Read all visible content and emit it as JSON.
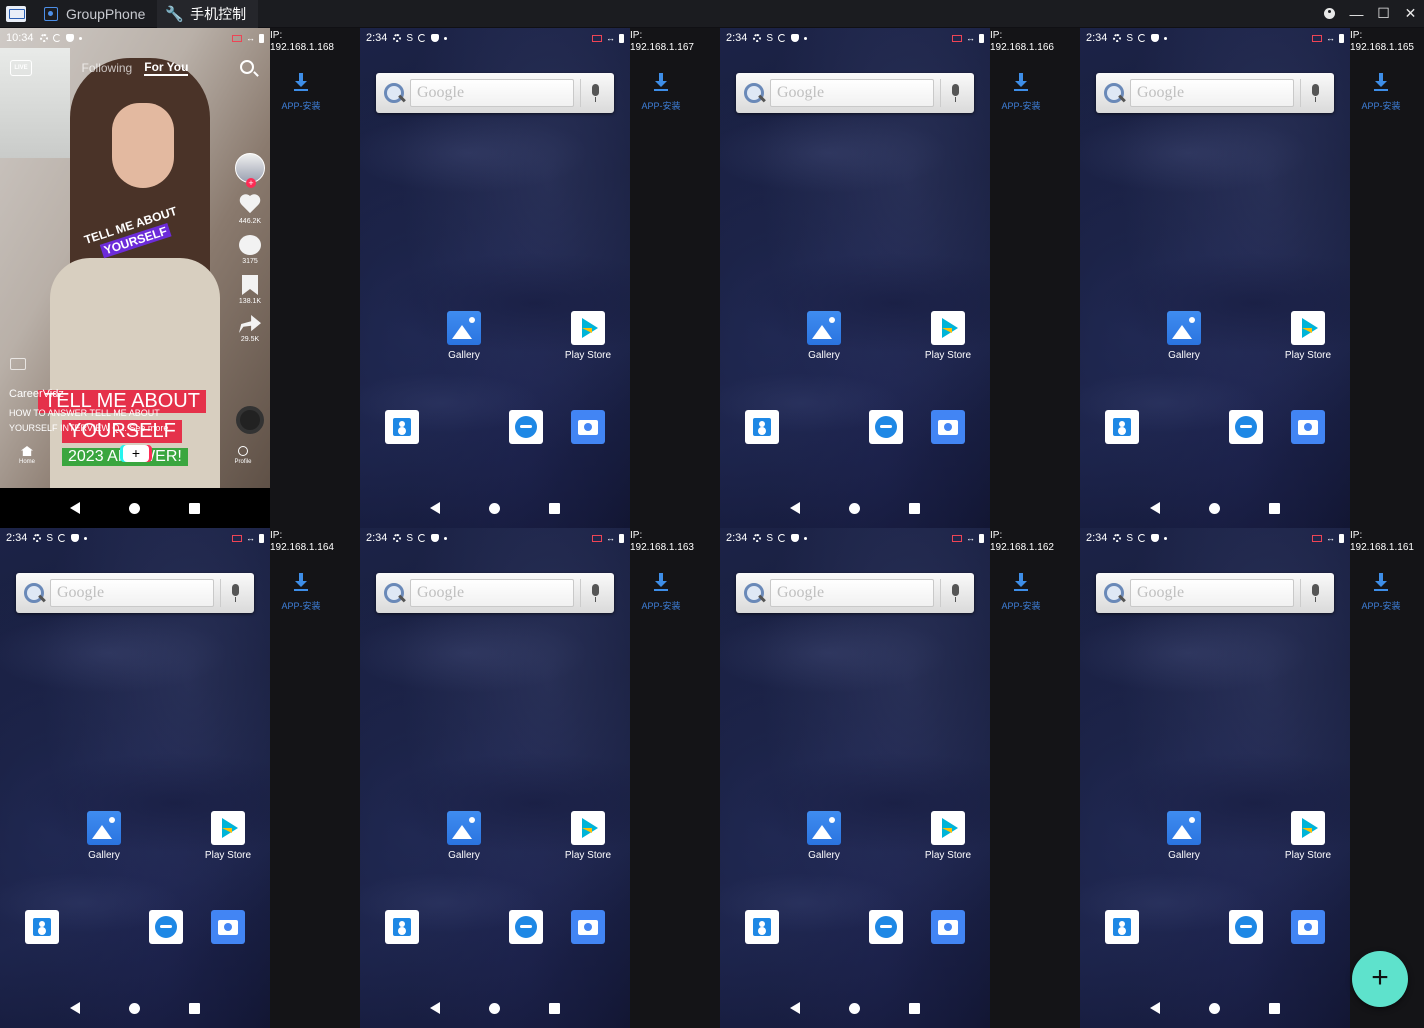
{
  "window": {
    "tabs": [
      {
        "label": "GroupPhone",
        "active": false,
        "icon": "phone-icon"
      },
      {
        "label": "手机控制",
        "active": true,
        "icon": "wrench-icon"
      }
    ],
    "controls": [
      "account-icon",
      "minimize-icon",
      "maximize-icon",
      "close-icon"
    ]
  },
  "install_label": "APP-安装",
  "fab_label": "+",
  "home_screen": {
    "search_placeholder": "Google",
    "apps": [
      {
        "label": "Gallery",
        "icon": "gallery-icon"
      },
      {
        "label": "Play Store",
        "icon": "play-store-icon"
      }
    ],
    "dock": [
      "contacts-icon",
      "browser-icon",
      "camera-icon"
    ]
  },
  "devices": [
    {
      "ip_label": "IP:",
      "ip": "192.168.1.168",
      "time": "10:34",
      "screen": "tiktok"
    },
    {
      "ip_label": "IP:",
      "ip": "192.168.1.167",
      "time": "2:34",
      "screen": "home"
    },
    {
      "ip_label": "IP:",
      "ip": "192.168.1.166",
      "time": "2:34",
      "screen": "home"
    },
    {
      "ip_label": "IP:",
      "ip": "192.168.1.165",
      "time": "2:34",
      "screen": "home"
    },
    {
      "ip_label": "IP:",
      "ip": "192.168.1.164",
      "time": "2:34",
      "screen": "home"
    },
    {
      "ip_label": "IP:",
      "ip": "192.168.1.163",
      "time": "2:34",
      "screen": "home"
    },
    {
      "ip_label": "IP:",
      "ip": "192.168.1.162",
      "time": "2:34",
      "screen": "home"
    },
    {
      "ip_label": "IP:",
      "ip": "192.168.1.161",
      "time": "2:34",
      "screen": "home"
    }
  ],
  "tiktok": {
    "live": "LIVE",
    "following": "Following",
    "for_you": "For You",
    "sticker_line1": "TELL ME ABOUT",
    "sticker_line2": "YOURSELF",
    "likes": "446.2K",
    "comments": "3175",
    "saves": "138.1K",
    "shares": "29.5K",
    "username": "CareerVidz",
    "description": "HOW TO ANSWER TELL ME ABOUT YOURSELF INTERVIEW Q...  See more",
    "caption_a": "TELL ME ABOUT",
    "caption_b": "YOURSELF",
    "caption_c": "2023 ANSWER!",
    "nav_home": "Home",
    "nav_profile": "Profile",
    "nav_plus": "+"
  }
}
